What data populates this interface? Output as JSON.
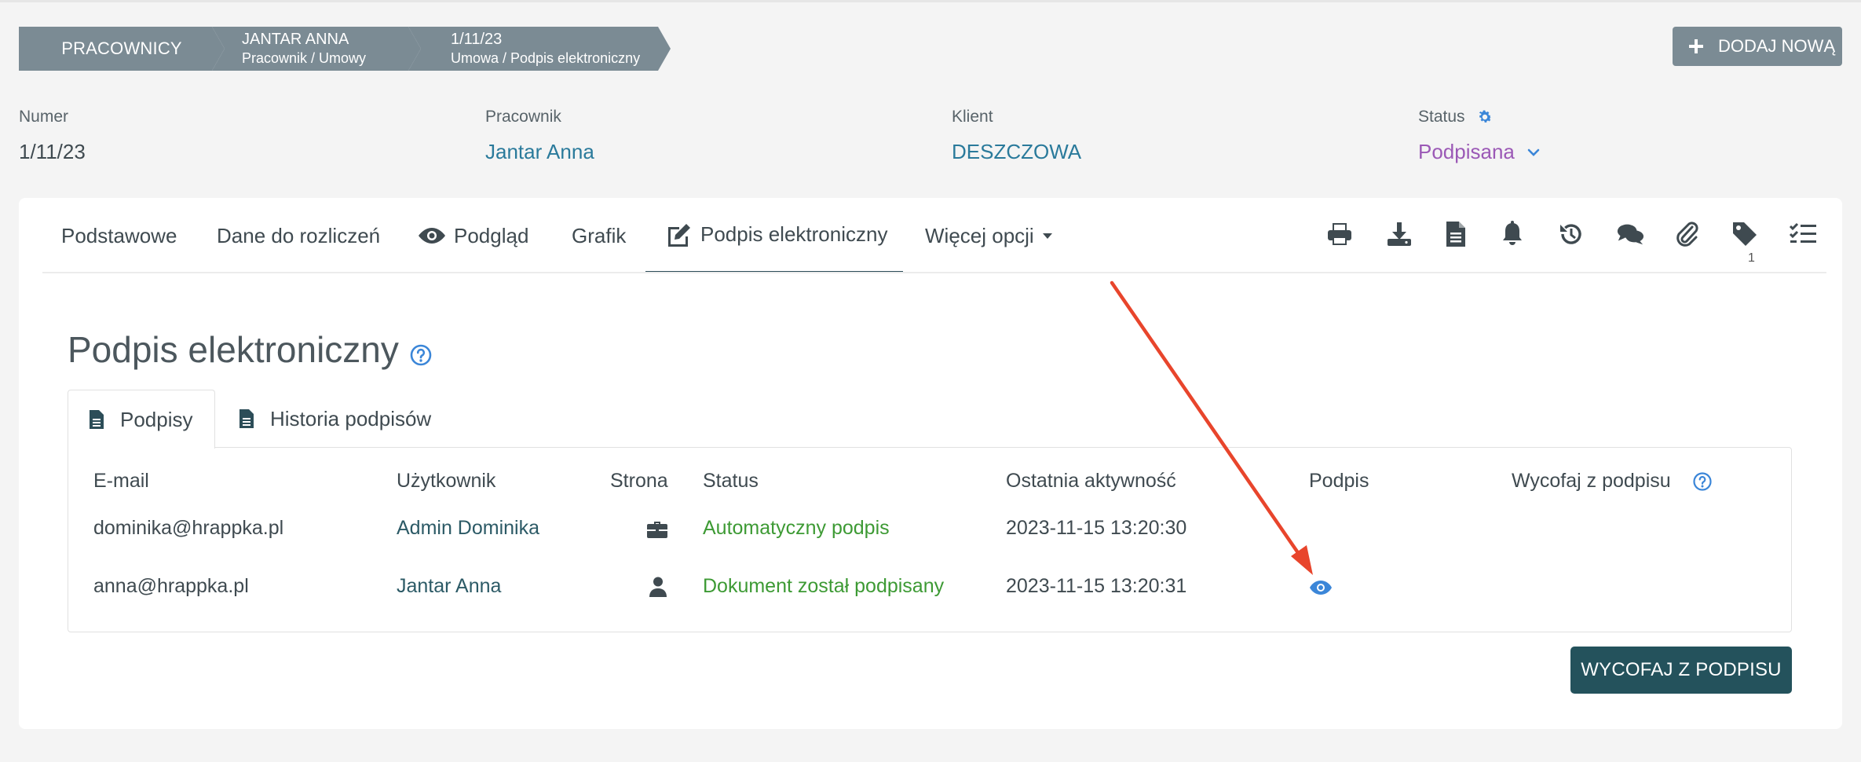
{
  "breadcrumb": {
    "root": "PRACOWNICY",
    "employee": {
      "title": "JANTAR ANNA",
      "subtitle": "Pracownik / Umowy"
    },
    "contract": {
      "title": "1/11/23",
      "subtitle": "Umowa / Podpis elektroniczny"
    }
  },
  "actions": {
    "add_new": "DODAJ NOWĄ"
  },
  "info": {
    "number": {
      "label": "Numer",
      "value": "1/11/23"
    },
    "employee": {
      "label": "Pracownik",
      "value": "Jantar Anna"
    },
    "client": {
      "label": "Klient",
      "value": "DESZCZOWA"
    },
    "status": {
      "label": "Status",
      "value": "Podpisana"
    }
  },
  "tabs": [
    {
      "label": "Podstawowe"
    },
    {
      "label": "Dane do rozliczeń"
    },
    {
      "label": "Podgląd"
    },
    {
      "label": "Grafik"
    },
    {
      "label": "Podpis elektroniczny"
    },
    {
      "label": "Więcej opcji"
    }
  ],
  "toolbar": {
    "icons": [
      "print-icon",
      "download-icon",
      "document-icon",
      "bell-icon",
      "history-icon",
      "comments-icon",
      "paperclip-icon",
      "tag-icon",
      "checklist-icon"
    ],
    "tags_count": "1"
  },
  "section": {
    "title": "Podpis elektroniczny",
    "subtabs": [
      {
        "label": "Podpisy"
      },
      {
        "label": "Historia podpisów"
      }
    ]
  },
  "table": {
    "headers": {
      "email": "E-mail",
      "user": "Użytkownik",
      "side": "Strona",
      "status": "Status",
      "last_activity": "Ostatnia aktywność",
      "signature": "Podpis",
      "withdraw": "Wycofaj z podpisu"
    },
    "rows": [
      {
        "email": "dominika@hrappka.pl",
        "user": "Admin Dominika",
        "side_icon": "briefcase-icon",
        "status": "Automatyczny podpis",
        "last_activity": "2023-11-15 13:20:30"
      },
      {
        "email": "anna@hrappka.pl",
        "user": "Jantar Anna",
        "side_icon": "user-icon",
        "status": "Dokument został podpisany",
        "last_activity": "2023-11-15 13:20:31",
        "signature_icon": "eye-icon"
      }
    ]
  },
  "withdraw_button": "WYCOFAJ Z PODPISU",
  "colors": {
    "breadcrumb_bg": "#7b8b94",
    "primary_dark": "#24525c",
    "status_purple": "#9b59b6",
    "success_green": "#3d9a34",
    "link_blue": "#3b86d8",
    "annotation_arrow": "#e8452c"
  }
}
